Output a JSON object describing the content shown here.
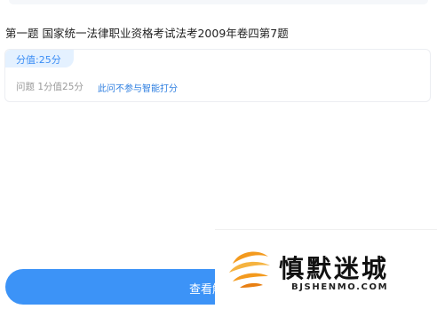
{
  "question": {
    "title": "第一题  国家统一法律职业资格考试法考2009年卷四第7题"
  },
  "card": {
    "score_tag": "分值:25分",
    "meta": "问题 1分值25分",
    "ai_note": "此问不参与智能打分"
  },
  "footer": {
    "view_button_label": "查看解析"
  },
  "watermark": {
    "title": "慎默迷城",
    "domain": "BJSHENMO.COM"
  },
  "colors": {
    "accent": "#3c93f7",
    "tag_bg": "#e4f1ff",
    "logo_orange": "#f39a1e"
  },
  "icons": {
    "watermark_logo": "swirl-logo-icon"
  }
}
